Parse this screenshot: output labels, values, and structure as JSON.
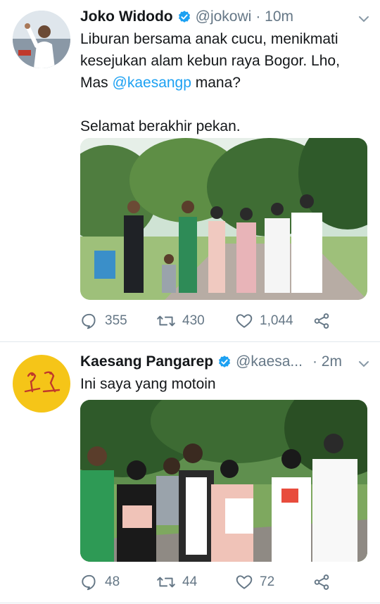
{
  "tweets": [
    {
      "author": "Joko Widodo",
      "handle": "@jokowi",
      "time": "· 10m",
      "text_before": "Liburan bersama anak cucu, menikmati kesejukan alam kebun raya Bogor. Lho, Mas ",
      "mention": "@kaesangp",
      "text_after": " mana?\n\nSelamat berakhir pekan.",
      "replies": "355",
      "retweets": "430",
      "likes": "1,044"
    },
    {
      "author": "Kaesang Pangarep",
      "handle": "@kaesa...",
      "time": "· 2m",
      "text": "Ini saya yang motoin",
      "replies": "48",
      "retweets": "44",
      "likes": "72"
    }
  ],
  "colors": {
    "accent": "#1da1f2",
    "muted": "#657786",
    "divider": "#e1e8ed",
    "avatar2_bg": "#f5c518"
  },
  "icons": [
    "verified-badge-icon",
    "chevron-down-icon",
    "reply-icon",
    "retweet-icon",
    "like-icon",
    "share-icon"
  ]
}
